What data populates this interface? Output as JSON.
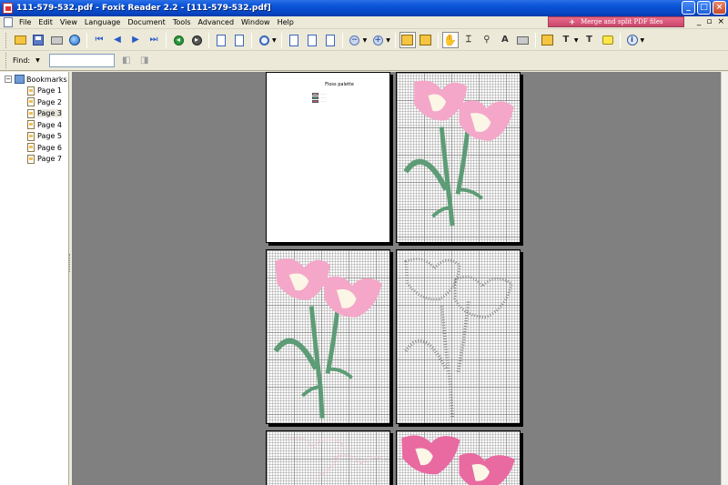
{
  "window": {
    "title": "111-579-532.pdf - Foxit Reader 2.2 - [111-579-532.pdf]",
    "controls": [
      "_",
      "□",
      "×"
    ]
  },
  "menu": [
    "File",
    "Edit",
    "View",
    "Language",
    "Document",
    "Tools",
    "Advanced",
    "Window",
    "Help"
  ],
  "ad_banner": "Merge and split PDF files",
  "doc_controls": [
    "_",
    "▫",
    "×"
  ],
  "find": {
    "label": "Find:",
    "value": ""
  },
  "bookmarks": {
    "root_label": "Bookmarks",
    "toggle": "−",
    "pages": [
      "Page 1",
      "Page 2",
      "Page 3",
      "Page 4",
      "Page 5",
      "Page 6",
      "Page 7"
    ],
    "selected_index": 2
  },
  "document": {
    "palette": {
      "title": "Floss palette",
      "colors": [
        "#f4a7c8",
        "#6aa583",
        "#d64f8a"
      ]
    },
    "colors": {
      "petal_pink": "#f4a7c8",
      "petal_dark": "#e86aa0",
      "petal_inner": "#fbf6e6",
      "stem_green": "#5d9c76",
      "preview_gray": "#8a8a8a"
    }
  },
  "icons": [
    "open-icon",
    "save-icon",
    "print-icon",
    "email-icon",
    "first-page-icon",
    "previous-page-icon",
    "next-page-icon",
    "last-page-icon",
    "go-back-icon",
    "go-forward-icon",
    "rotate-left-icon",
    "rotate-right-icon",
    "zoom-icon",
    "single-page-icon",
    "continuous-page-icon",
    "facing-page-icon",
    "zoom-out-icon",
    "zoom-in-icon",
    "bookmark-panel-icon",
    "thumbnail-icon",
    "hand-tool-icon",
    "select-text-icon",
    "find-icon",
    "text-tool-icon",
    "snapshot-icon",
    "comment-icon",
    "typewriter-icon",
    "note-icon",
    "info-icon"
  ]
}
